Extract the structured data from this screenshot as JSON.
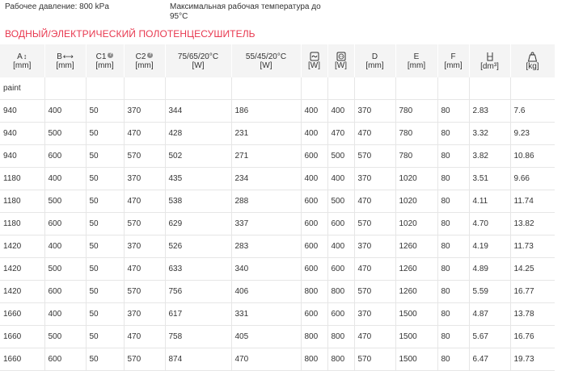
{
  "info": {
    "pressure": "Рабочее давление: 800 kPa",
    "temperature": "Максимальная рабочая температура до 95°C"
  },
  "title": "ВОДНЫЙ/ЭЛЕКТРИЧЕСКИЙ ПОЛОТЕНЦЕСУШИТЕЛЬ",
  "headers": {
    "A": "A",
    "A_unit": "[mm]",
    "B": "B",
    "B_unit": "[mm]",
    "C1": "C1",
    "C1_unit": "[mm]",
    "C2": "C2",
    "C2_unit": "[mm]",
    "T1": "75/65/20°C",
    "T1_unit": "[W]",
    "T2": "55/45/20°C",
    "T2_unit": "[W]",
    "P1_unit": "[W]",
    "P2_unit": "[W]",
    "D": "D",
    "D_unit": "[mm]",
    "E": "E",
    "E_unit": "[mm]",
    "F": "F",
    "F_unit": "[mm]",
    "V_unit": "[dm³]",
    "M_unit": "[kg]"
  },
  "group_label": "paint",
  "rows": [
    [
      "940",
      "400",
      "50",
      "370",
      "344",
      "186",
      "400",
      "400",
      "370",
      "780",
      "80",
      "2.83",
      "7.6"
    ],
    [
      "940",
      "500",
      "50",
      "470",
      "428",
      "231",
      "400",
      "470",
      "470",
      "780",
      "80",
      "3.32",
      "9.23"
    ],
    [
      "940",
      "600",
      "50",
      "570",
      "502",
      "271",
      "600",
      "500",
      "570",
      "780",
      "80",
      "3.82",
      "10.86"
    ],
    [
      "1180",
      "400",
      "50",
      "370",
      "435",
      "234",
      "400",
      "400",
      "370",
      "1020",
      "80",
      "3.51",
      "9.66"
    ],
    [
      "1180",
      "500",
      "50",
      "470",
      "538",
      "288",
      "600",
      "500",
      "470",
      "1020",
      "80",
      "4.11",
      "11.74"
    ],
    [
      "1180",
      "600",
      "50",
      "570",
      "629",
      "337",
      "600",
      "600",
      "570",
      "1020",
      "80",
      "4.70",
      "13.82"
    ],
    [
      "1420",
      "400",
      "50",
      "370",
      "526",
      "283",
      "600",
      "400",
      "370",
      "1260",
      "80",
      "4.19",
      "11.73"
    ],
    [
      "1420",
      "500",
      "50",
      "470",
      "633",
      "340",
      "600",
      "600",
      "470",
      "1260",
      "80",
      "4.89",
      "14.25"
    ],
    [
      "1420",
      "600",
      "50",
      "570",
      "756",
      "406",
      "800",
      "800",
      "570",
      "1260",
      "80",
      "5.59",
      "16.77"
    ],
    [
      "1660",
      "400",
      "50",
      "370",
      "617",
      "331",
      "600",
      "600",
      "370",
      "1500",
      "80",
      "4.87",
      "13.78"
    ],
    [
      "1660",
      "500",
      "50",
      "470",
      "758",
      "405",
      "800",
      "800",
      "470",
      "1500",
      "80",
      "5.67",
      "16.76"
    ],
    [
      "1660",
      "600",
      "50",
      "570",
      "874",
      "470",
      "800",
      "800",
      "570",
      "1500",
      "80",
      "6.47",
      "19.73"
    ]
  ],
  "icons": {
    "a_arrow": "vertical-arrow-icon",
    "b_arrow": "horizontal-arrow-icon",
    "info": "info-icon",
    "power1": "heating-element-icon",
    "power2": "electric-socket-icon",
    "volume": "volume-container-icon",
    "mass": "weight-icon"
  },
  "colors": {
    "title": "#e8384f",
    "header_bg": "#f4f4f4",
    "grid": "#e6e6e6"
  }
}
